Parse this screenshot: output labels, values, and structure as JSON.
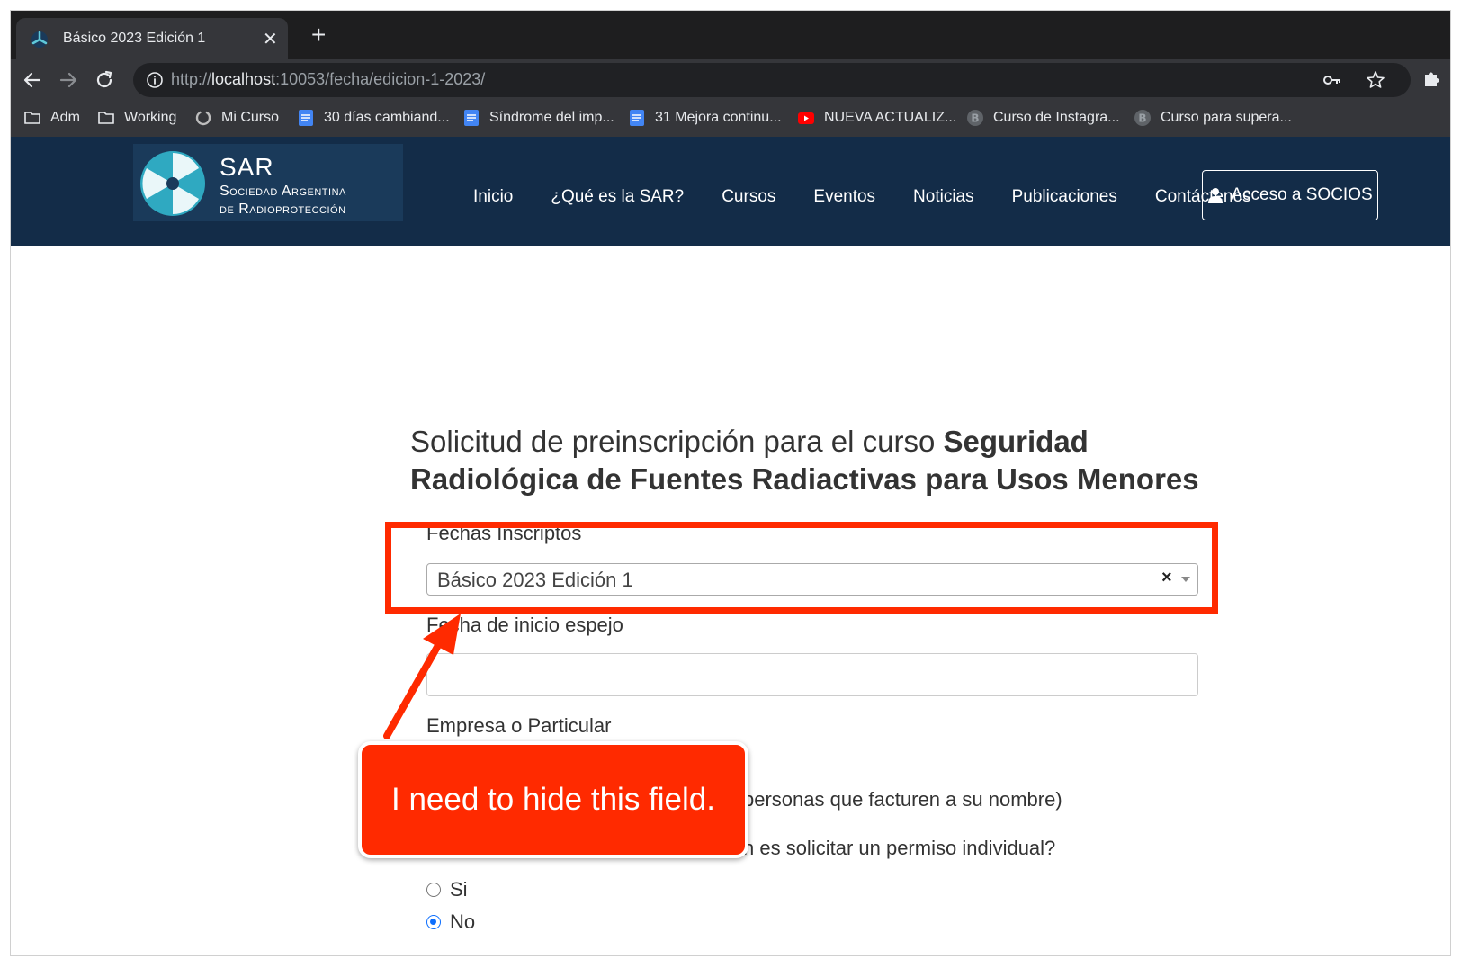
{
  "browser": {
    "tab_title": "Básico 2023 Edición 1",
    "url_prefix": "http://",
    "url_host": "localhost",
    "url_rest": ":10053/fecha/edicion-1-2023/",
    "new_tab_icon": "plus-icon",
    "bookmarks": [
      {
        "label": "Adm",
        "icon": "folder-icon"
      },
      {
        "label": "Working",
        "icon": "folder-icon"
      },
      {
        "label": "Mi Curso",
        "icon": "circle-logo-icon"
      },
      {
        "label": "30 días cambiand...",
        "icon": "docs-icon"
      },
      {
        "label": "Síndrome del imp...",
        "icon": "docs-icon"
      },
      {
        "label": "31 Mejora continu...",
        "icon": "docs-icon"
      },
      {
        "label": "NUEVA ACTUALIZ...",
        "icon": "youtube-icon"
      },
      {
        "label": "Curso de Instagra...",
        "icon": "b-circle-icon"
      },
      {
        "label": "Curso para supera...",
        "icon": "b-circle-icon"
      }
    ]
  },
  "site": {
    "logo_title": "SAR",
    "logo_line1": "Sociedad Argentina",
    "logo_line2": "de Radioprotección",
    "nav": [
      "Inicio",
      "¿Qué es la SAR?",
      "Cursos",
      "Eventos",
      "Noticias",
      "Publicaciones",
      "Contáctenos"
    ],
    "socios_button": "Acceso a SOCIOS",
    "header_color": "#132c48"
  },
  "form": {
    "title_normal": "Solicitud de preinscripción para el curso ",
    "title_bold": "Seguridad Radiológica de Fuentes Radiactivas para Usos Menores",
    "fechas_label": "Fechas Inscriptos",
    "fechas_value": "Básico 2023 Edición 1",
    "fecha_espejo_label": "Fecha de inicio espejo",
    "fecha_espejo_value": "",
    "empresa_label": "Empresa o Particular",
    "partial_option_text": "personas que facturen a su nombre)",
    "partial_question_text": "n es solicitar un permiso individual?",
    "radio_si": "Si",
    "radio_no": "No"
  },
  "annotation": {
    "callout_text": "I need to hide this field.",
    "color": "#ff2a00"
  }
}
